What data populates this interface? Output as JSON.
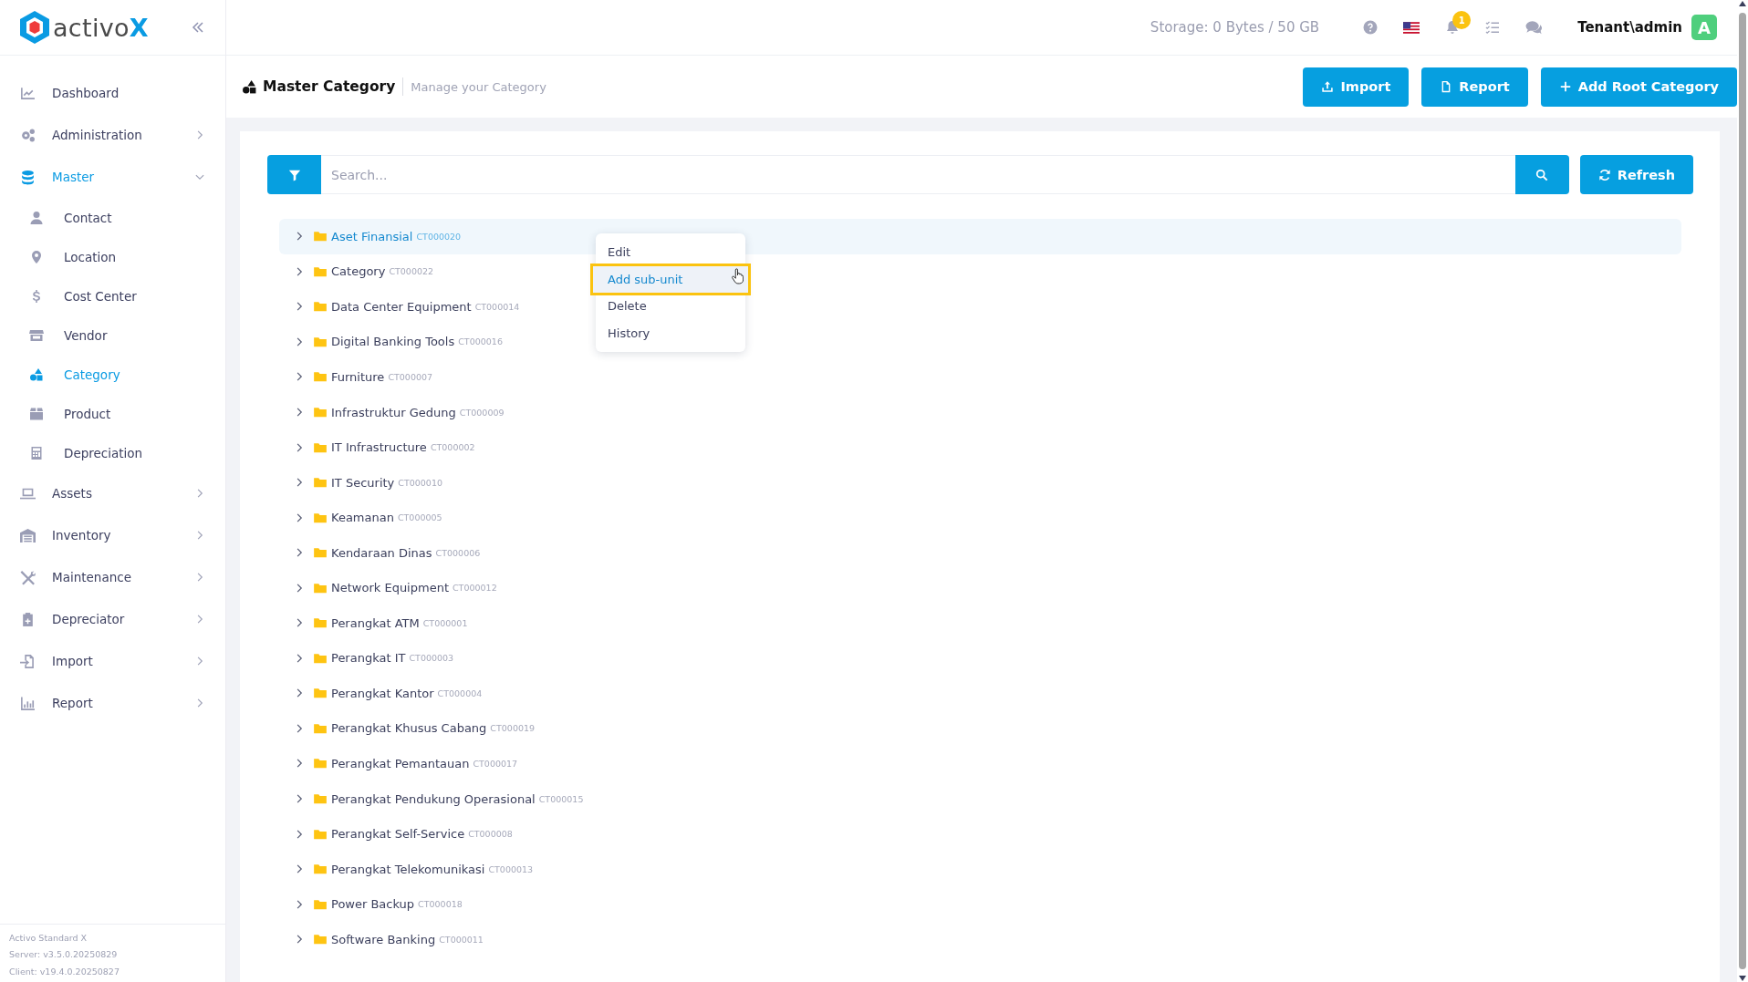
{
  "logo": {
    "text": "activo",
    "accent": "X"
  },
  "sidebar": {
    "items": [
      {
        "label": "Dashboard",
        "selected": false
      },
      {
        "label": "Administration",
        "selected": false,
        "expanded": false
      },
      {
        "label": "Master",
        "selected": true,
        "expanded": true,
        "children": [
          {
            "label": "Contact",
            "selected": false
          },
          {
            "label": "Location",
            "selected": false
          },
          {
            "label": "Cost Center",
            "selected": false
          },
          {
            "label": "Vendor",
            "selected": false
          },
          {
            "label": "Category",
            "selected": true
          },
          {
            "label": "Product",
            "selected": false
          },
          {
            "label": "Depreciation",
            "selected": false
          }
        ]
      },
      {
        "label": "Assets",
        "selected": false,
        "expanded": false
      },
      {
        "label": "Inventory",
        "selected": false,
        "expanded": false
      },
      {
        "label": "Maintenance",
        "selected": false,
        "expanded": false
      },
      {
        "label": "Depreciator",
        "selected": false,
        "expanded": false
      },
      {
        "label": "Import",
        "selected": false,
        "expanded": false
      },
      {
        "label": "Report",
        "selected": false,
        "expanded": false
      }
    ],
    "footer": [
      "Activo Standard X",
      "Server: v3.5.0.20250829",
      "Client: v19.4.0.20250827"
    ]
  },
  "topbar": {
    "storage": "Storage: 0 Bytes / 50 GB",
    "notification_count": "1",
    "user": "Tenant\\admin",
    "avatar": "A"
  },
  "page": {
    "title": "Master Category",
    "subtitle": "Manage your Category",
    "buttons": [
      "Import",
      "Report",
      "Add Root Category"
    ]
  },
  "search": {
    "placeholder": "Search...",
    "refresh": "Refresh"
  },
  "tree": [
    {
      "name": "Aset Finansial",
      "code": "CT000020",
      "selected": true,
      "expanded": false
    },
    {
      "name": "Category",
      "code": "CT000022",
      "selected": false,
      "expanded": false
    },
    {
      "name": "Data Center Equipment",
      "code": "CT000014",
      "selected": false,
      "expanded": false
    },
    {
      "name": "Digital Banking Tools",
      "code": "CT000016",
      "selected": false,
      "expanded": false
    },
    {
      "name": "Furniture",
      "code": "CT000007",
      "selected": false,
      "expanded": false
    },
    {
      "name": "Infrastruktur Gedung",
      "code": "CT000009",
      "selected": false,
      "expanded": false
    },
    {
      "name": "IT Infrastructure",
      "code": "CT000002",
      "selected": false,
      "expanded": false
    },
    {
      "name": "IT Security",
      "code": "CT000010",
      "selected": false,
      "expanded": false
    },
    {
      "name": "Keamanan",
      "code": "CT000005",
      "selected": false,
      "expanded": false
    },
    {
      "name": "Kendaraan Dinas",
      "code": "CT000006",
      "selected": false,
      "expanded": false
    },
    {
      "name": "Network Equipment",
      "code": "CT000012",
      "selected": false,
      "expanded": false
    },
    {
      "name": "Perangkat ATM",
      "code": "CT000001",
      "selected": false,
      "expanded": false
    },
    {
      "name": "Perangkat IT",
      "code": "CT000003",
      "selected": false,
      "expanded": false
    },
    {
      "name": "Perangkat Kantor",
      "code": "CT000004",
      "selected": false,
      "expanded": false
    },
    {
      "name": "Perangkat Khusus Cabang",
      "code": "CT000019",
      "selected": false,
      "expanded": false
    },
    {
      "name": "Perangkat Pemantauan",
      "code": "CT000017",
      "selected": false,
      "expanded": false
    },
    {
      "name": "Perangkat Pendukung Operasional",
      "code": "CT000015",
      "selected": false,
      "expanded": false
    },
    {
      "name": "Perangkat Self-Service",
      "code": "CT000008",
      "selected": false,
      "expanded": false
    },
    {
      "name": "Perangkat Telekomunikasi",
      "code": "CT000013",
      "selected": false,
      "expanded": false
    },
    {
      "name": "Power Backup",
      "code": "CT000018",
      "selected": false,
      "expanded": false
    },
    {
      "name": "Software Banking",
      "code": "CT000011",
      "selected": false,
      "expanded": false
    }
  ],
  "context_menu": {
    "items": [
      {
        "label": "Edit",
        "selected": false
      },
      {
        "label": "Add sub-unit",
        "selected": true
      },
      {
        "label": "Delete",
        "selected": false
      },
      {
        "label": "History",
        "selected": false
      }
    ]
  }
}
